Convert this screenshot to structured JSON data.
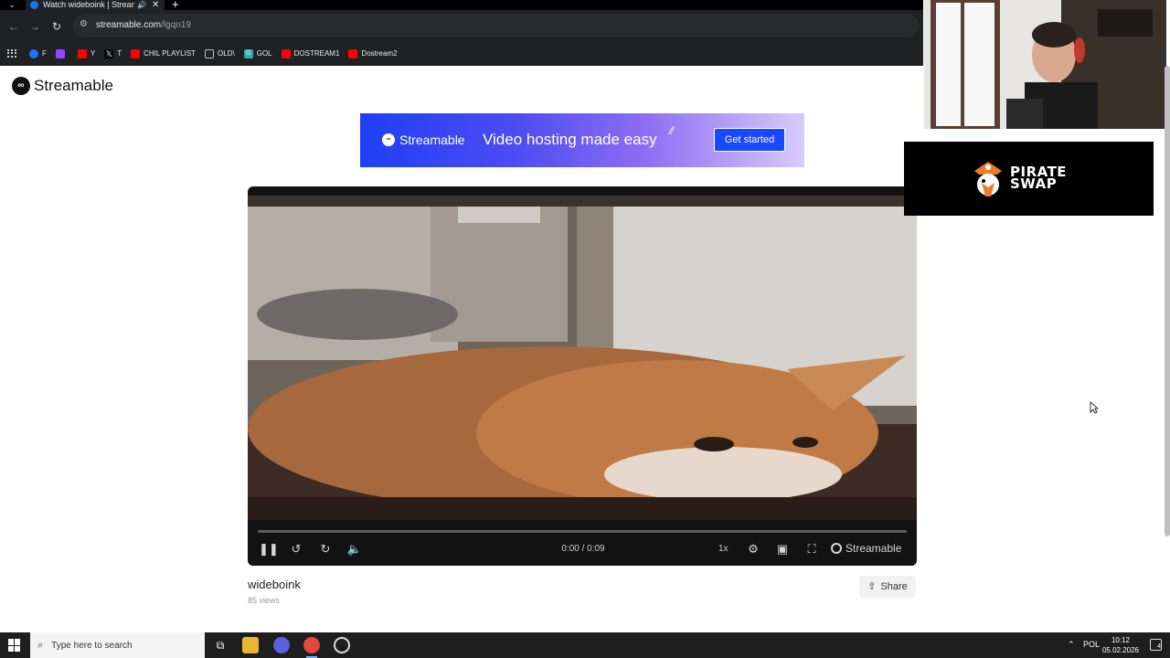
{
  "browser": {
    "tab": {
      "title": "Watch wideboink | Streamable"
    },
    "new_tab_label": "+",
    "omnibox": {
      "domain": "streamable.com",
      "path": "/lgqn19"
    },
    "bookmarks": [
      {
        "label": "F",
        "color": "#1877f2"
      },
      {
        "label": "",
        "color": "#9146ff"
      },
      {
        "label": "Y",
        "color": "#ff0000"
      },
      {
        "label": "T",
        "color": "#000000"
      },
      {
        "label": "CHIL PLAYLIST",
        "color": "#ff0000"
      },
      {
        "label": "OLD\\",
        "color": "#bdbdbd"
      },
      {
        "label": "GOL",
        "color": "#35a7b2"
      },
      {
        "label": "DOSTREAM1",
        "color": "#ff0000"
      },
      {
        "label": "Dostream2",
        "color": "#ff0000"
      }
    ]
  },
  "page": {
    "logo_text": "Streamable",
    "ad_banner": {
      "brand": "Streamable",
      "tagline": "Video hosting made easy",
      "cta": "Get started"
    },
    "player": {
      "time": "0:00 / 0:09",
      "speed": "1x",
      "watermark": "Streamable",
      "progress_fraction": 0.0
    },
    "video": {
      "title": "wideboink",
      "views": "85 views",
      "share_label": "Share"
    }
  },
  "overlay": {
    "sponsor_line1": "PIRATE",
    "sponsor_line2": "SWAP"
  },
  "taskbar": {
    "search_placeholder": "Type here to search",
    "language": "POL",
    "time": "10:12",
    "date": "05.02.2026",
    "notification_count": "4"
  },
  "colors": {
    "accent": "#1848ff",
    "chrome_bg": "#202124",
    "sponsor_orange": "#f07a2b"
  }
}
